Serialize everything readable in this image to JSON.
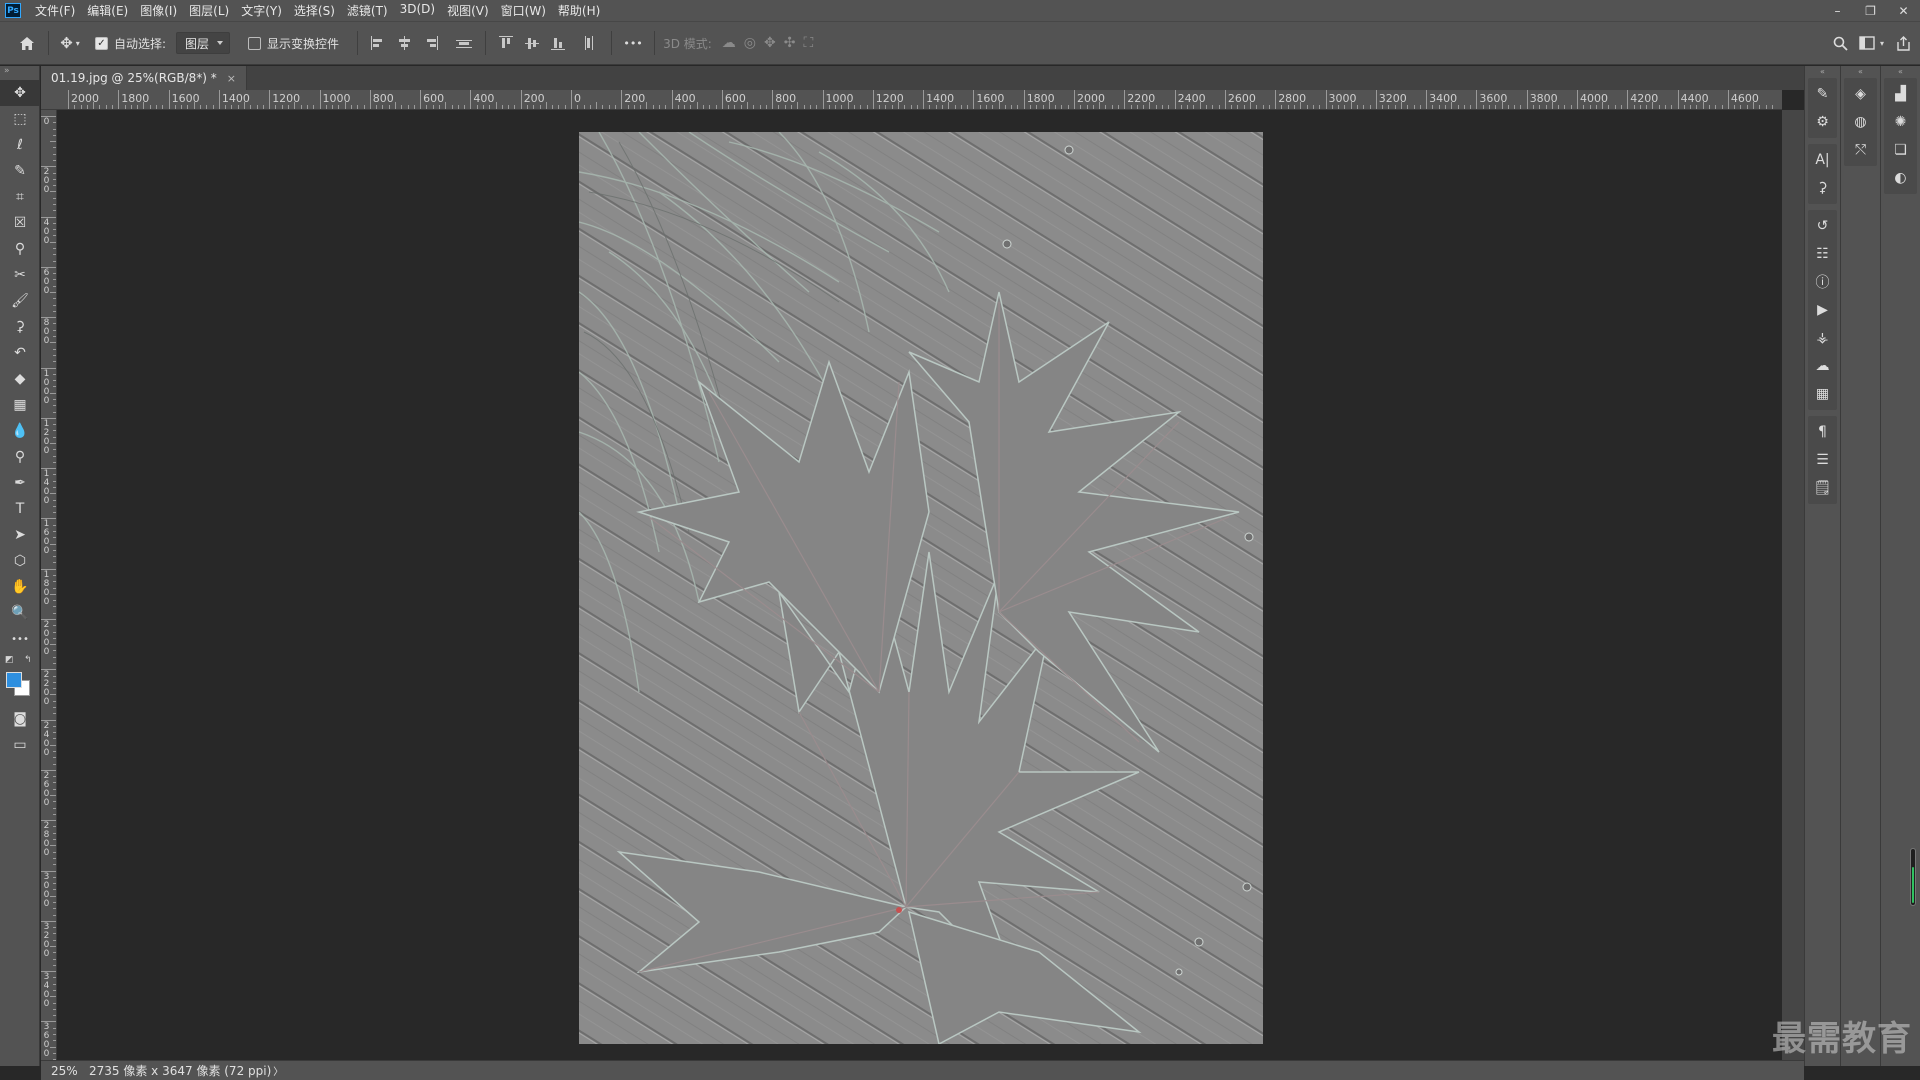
{
  "app": {
    "logo": "Ps",
    "menu": [
      "文件(F)",
      "编辑(E)",
      "图像(I)",
      "图层(L)",
      "文字(Y)",
      "选择(S)",
      "滤镜(T)",
      "3D(D)",
      "视图(V)",
      "窗口(W)",
      "帮助(H)"
    ],
    "window_controls": {
      "minimize": "–",
      "restore": "❐",
      "close": "✕"
    }
  },
  "options_bar": {
    "auto_select_label": "自动选择:",
    "auto_select_checked": true,
    "auto_select_target": "图层",
    "show_transform_label": "显示变换控件",
    "show_transform_checked": false,
    "more": "•••",
    "mode_3d_label": "3D 模式:"
  },
  "document": {
    "tab_title": "01.19.jpg @ 25%(RGB/8*) *",
    "close": "×",
    "zoom": "25%",
    "status_info": "2735 像素 x 3647 像素 (72 ppi)",
    "status_arrow": "〉"
  },
  "rulers": {
    "horizontal": [
      "2000",
      "1800",
      "1600",
      "1400",
      "1200",
      "1000",
      "800",
      "600",
      "400",
      "200",
      "0",
      "200",
      "400",
      "600",
      "800",
      "1000",
      "1200",
      "1400",
      "1600",
      "1800",
      "2000",
      "2200",
      "2400",
      "2600",
      "2800",
      "3000",
      "3200",
      "3400",
      "3600",
      "3800",
      "4000",
      "4200",
      "4400",
      "4600"
    ],
    "vertical": [
      "0",
      "200",
      "400",
      "600",
      "800",
      "1000",
      "1200",
      "1400",
      "1600",
      "1800",
      "2000",
      "2200",
      "2400",
      "2600",
      "2800",
      "3000",
      "3200",
      "3400",
      "3600"
    ]
  },
  "colors": {
    "foreground": "#2e8fdf",
    "background": "#ffffff",
    "ui_dark": "#535353",
    "canvas_bg": "#282828"
  },
  "tools": [
    {
      "name": "move-tool",
      "glyph": "✥",
      "active": true
    },
    {
      "name": "marquee-tool",
      "glyph": "⬚"
    },
    {
      "name": "lasso-tool",
      "glyph": "ℓ"
    },
    {
      "name": "quick-selection-tool",
      "glyph": "✎"
    },
    {
      "name": "crop-tool",
      "glyph": "⌗"
    },
    {
      "name": "frame-tool",
      "glyph": "☒"
    },
    {
      "name": "eyedropper-tool",
      "glyph": "⚲"
    },
    {
      "name": "healing-tool",
      "glyph": "✂"
    },
    {
      "name": "brush-tool",
      "glyph": "🖌"
    },
    {
      "name": "clone-stamp-tool",
      "glyph": "⚳"
    },
    {
      "name": "history-brush-tool",
      "glyph": "↶"
    },
    {
      "name": "eraser-tool",
      "glyph": "◆"
    },
    {
      "name": "gradient-tool",
      "glyph": "▦"
    },
    {
      "name": "blur-tool",
      "glyph": "💧"
    },
    {
      "name": "dodge-tool",
      "glyph": "⚲"
    },
    {
      "name": "pen-tool",
      "glyph": "✒"
    },
    {
      "name": "type-tool",
      "glyph": "T"
    },
    {
      "name": "path-selection-tool",
      "glyph": "➤"
    },
    {
      "name": "shape-tool",
      "glyph": "⬡"
    },
    {
      "name": "hand-tool",
      "glyph": "✋"
    },
    {
      "name": "zoom-tool",
      "glyph": "🔍"
    },
    {
      "name": "more-tools",
      "glyph": "•••"
    }
  ],
  "bottom_tools": [
    {
      "name": "quick-mask-button",
      "glyph": "◙"
    },
    {
      "name": "screen-mode-button",
      "glyph": "▭"
    }
  ],
  "panel_a_icons": [
    [
      "brush-settings-icon",
      "brushes-icon"
    ],
    [
      "character-icon",
      "clone-source-icon"
    ],
    [
      "history-icon",
      "properties-icon",
      "info-icon",
      "actions-icon",
      "tool-presets-icon",
      "3d-panel-icon",
      "table-icon"
    ],
    [
      "paragraph-icon",
      "paragraph-styles-icon",
      "notes-icon"
    ]
  ],
  "panel_a_glyphs": [
    [
      "✎",
      "⚙"
    ],
    [
      "A|",
      "⚳"
    ],
    [
      "↺",
      "☷",
      "ⓘ",
      "▶",
      "⚶",
      "☁",
      "▦"
    ],
    [
      "¶",
      "☰",
      "🗒"
    ]
  ],
  "panel_b": [
    {
      "name": "layers-icon",
      "glyph": "◈"
    },
    {
      "name": "channels-icon",
      "glyph": "◍"
    },
    {
      "name": "paths-icon",
      "glyph": "⤲"
    }
  ],
  "panel_c": [
    {
      "name": "histogram-icon",
      "glyph": "▟"
    },
    {
      "name": "navigator-icon",
      "glyph": "✺"
    },
    {
      "name": "libraries-icon",
      "glyph": "❏"
    },
    {
      "name": "adjustments-icon",
      "glyph": "◐"
    }
  ],
  "watermark": "最需教育"
}
